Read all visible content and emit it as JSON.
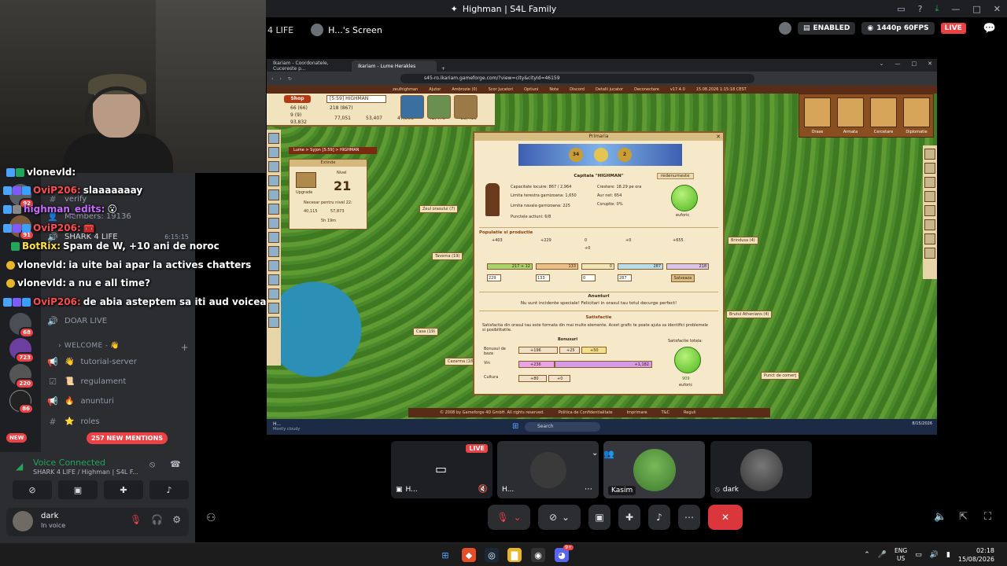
{
  "window": {
    "title": "Highman | S4L Family",
    "controls": [
      "—",
      "□",
      "✕"
    ]
  },
  "stream_header": {
    "channel": "4 LIFE",
    "streamer_label": "H...'s Screen",
    "enabled_label": "ENABLED",
    "quality_label": "1440p 60FPS",
    "live_label": "LIVE"
  },
  "chat": {
    "messages": [
      {
        "user": "vlonevld:",
        "text": "",
        "user_color": "#ffffff"
      },
      {
        "user": "OviP206:",
        "text": "slaaaaaaay",
        "user_color": "#ff4b4b"
      },
      {
        "user": "highman_edits:",
        "text": "😮",
        "user_color": "#c86bff"
      },
      {
        "user": "OviP206:",
        "text": "",
        "user_color": "#ff4b4b"
      },
      {
        "user": "BotRix:",
        "text": "Spam de W, +10 ani de noroc",
        "user_color": "#ffe04b"
      },
      {
        "user": "vlonevld:",
        "text": "ia uite bai apar la actives chatters",
        "user_color": "#ffffff"
      },
      {
        "user": "vlonevld:",
        "text": "a nu e all time?",
        "user_color": "#ffffff"
      },
      {
        "user": "OviP206:",
        "text": "de abia asteptem sa iti aud voicea",
        "user_color": "#ff4b4b"
      }
    ]
  },
  "sidebar": {
    "server_badges": [
      "92",
      "91",
      "68",
      "723",
      "220",
      "86"
    ],
    "new_label": "NEW",
    "channels": [
      {
        "icon": "#",
        "label": "verify"
      },
      {
        "icon": "👤",
        "label": "Members: 19136"
      },
      {
        "icon": "🔊",
        "label": "SHARK 4 LIFE",
        "time": "6:15:15"
      },
      {
        "icon": "🔊",
        "label": "DOAR LIVE"
      }
    ],
    "category": "WELCOME - 👋",
    "welcome_channels": [
      {
        "icon": "📢",
        "label": "tutorial-server",
        "emoji": "👋"
      },
      {
        "icon": "☑",
        "label": "regulament",
        "emoji": "📜"
      },
      {
        "icon": "📢",
        "label": "anunturi",
        "emoji": "🔥"
      },
      {
        "icon": "#",
        "label": "roles",
        "emoji": "⭐"
      }
    ],
    "mentions_label": "257 NEW MENTIONS",
    "voice_connected": "Voice Connected",
    "voice_sub": "SHARK 4 LIFE / Highman | S4L F...",
    "user_name": "dark",
    "user_status": "In voice"
  },
  "game": {
    "tabs": [
      "Ikariam - Coordonatele, Cucereste p...",
      "Ikariam - Lume Herakles"
    ],
    "url": "s45-ro.ikariam.gameforge.com/?view=city&cityId=46159",
    "menu": [
      "zeulhighman",
      "Ajutor",
      "Ambrozie (0)",
      "Scor Jucatori",
      "Optiuni",
      "Note",
      "Discord",
      "Detalii jucator",
      "Deconectare",
      "v17.4.0",
      "15.08.2026 1:15:18 CEST"
    ],
    "shop_label": "Shop",
    "city_select": "[5:59] HIGHMAN",
    "resources": [
      "66 (66)",
      "9 (9)",
      "93,832",
      "218 (867)",
      "77,051",
      "53,407",
      "47,908",
      "42,476",
      "18,410"
    ],
    "view_labels": [
      "Arata lumea",
      "Arata insula",
      "Arata orasul"
    ],
    "breadcrumb": "Lume > Syjon [5:59] > HIGHMAN",
    "advisors": [
      "Orase",
      "Armata",
      "Cercetare",
      "Diplomatie"
    ],
    "extinde": {
      "title": "Extinde",
      "nivel": "Nivel",
      "level": "21",
      "upgrade": "Upgrade",
      "need": "Necesar pentru nivel 22:",
      "wood": "40,115",
      "marble": "57,873",
      "time": "5h 19m"
    },
    "town_labels": [
      "Zeul orasului (7)",
      "Taverna (19)",
      "Brindusa (4)",
      "Casa (19)",
      "Cazarma (18)",
      "Punct de comerţ",
      "Brutul Athenians (4)",
      "Punct de..."
    ],
    "dialog": {
      "title": "Primaria",
      "banner_left": "34",
      "banner_right": "2",
      "capital_title": "Capitala \"HIGHMAN\"",
      "link_label": "redenumeste",
      "stats_left": [
        "Capacitate locuire: 867 / 2,964",
        "Limita terestra garnizoana: 1,650",
        "Limita navala garnizoana: 225",
        "Punctele actiuni: 6/8"
      ],
      "stats_right": [
        "Crestere: 18.29 pe ora",
        "Aur net: 654",
        "Coruptie: 0%"
      ],
      "mood": "euforic",
      "section_pop": "Populatie si productie",
      "prod_top": [
        "+403",
        "+229",
        "0",
        "+0",
        "+0",
        "+655"
      ],
      "prod_bars": [
        "217 + 12",
        "133",
        "0",
        "287",
        "218"
      ],
      "prod_inputs": [
        "229",
        "133",
        "0",
        "287"
      ],
      "save_label": "Salveaza",
      "news_label": "Anunturi",
      "news_text": "Nu sunt incidente speciale! Felicitari in orasul tau totul decurge perfect!",
      "satisfaction_label": "Satisfactie",
      "satisfaction_text": "Satisfactia din orasul tau este formata din mai multe elemente. Acest grafic te poate ajuta sa identifici problemele si posibilitatile.",
      "bonus_label": "Bonusuri",
      "bonus_rows": [
        {
          "label": "Bonusul de baza",
          "values": [
            "+196",
            "+25",
            "+50"
          ]
        },
        {
          "label": "Vin",
          "values": [
            "+236",
            "+1,182"
          ]
        },
        {
          "label": "Cultura",
          "values": [
            "+80",
            "+0"
          ]
        }
      ],
      "total_label": "Satisfactie totala:",
      "total_value": "909",
      "total_mood": "euforic"
    },
    "footer": [
      "© 2008 by Gameforge 4D GmbH. All rights reserved.",
      "Politica de Confidentialitate",
      "Imprimare",
      "T&C",
      "Reguli"
    ],
    "taskbar": {
      "weather_name": "H...",
      "weather_sub": "Mostly cloudy",
      "search": "Search",
      "date": "8/15/2026"
    }
  },
  "participants": [
    {
      "name": "H...",
      "live": "LIVE"
    },
    {
      "name": "H..."
    },
    {
      "name": "Kasim"
    },
    {
      "name": "dark"
    }
  ],
  "taskbar": {
    "lang_top": "ENG",
    "lang_bottom": "US",
    "time": "02:18",
    "date": "15/08/2026",
    "discord_badge": "9+"
  },
  "colors": {
    "discord_bg": "#2b2d31",
    "danger": "#ed4245",
    "success": "#23a55a"
  }
}
